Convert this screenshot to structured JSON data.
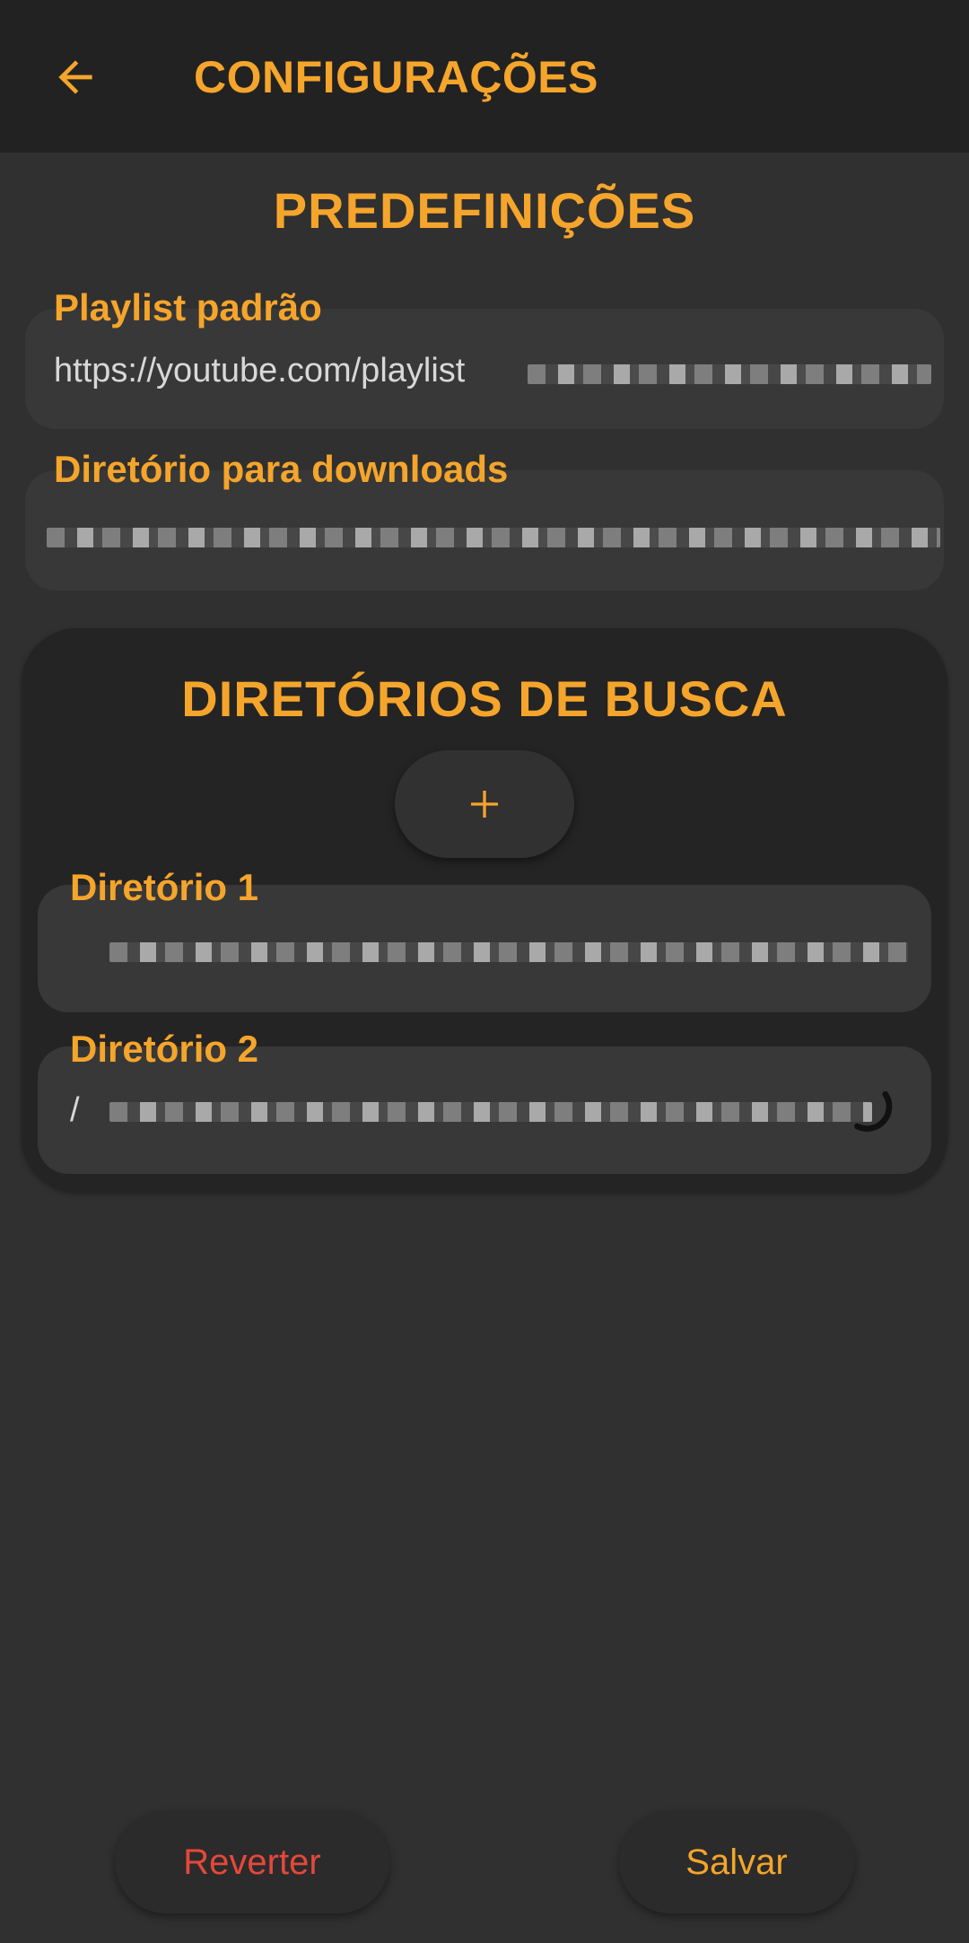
{
  "appbar": {
    "title": "CONFIGURAÇÕES",
    "back_icon": "arrow-left-icon"
  },
  "presets": {
    "title": "PREDEFINIÇÕES",
    "playlist": {
      "label": "Playlist padrão",
      "value": "https://youtube.com/playlist"
    },
    "download_dir": {
      "label": "Diretório para downloads",
      "value": ""
    }
  },
  "search_dirs": {
    "title": "DIRETÓRIOS DE BUSCA",
    "add_icon": "plus-icon",
    "items": [
      {
        "label": "Diretório 1",
        "value": ""
      },
      {
        "label": "Diretório 2",
        "value": "/"
      }
    ]
  },
  "footer": {
    "revert_label": "Reverter",
    "save_label": "Salvar"
  },
  "colors": {
    "accent": "#f5a52b",
    "danger": "#e5483b",
    "background": "#303030",
    "appbar": "#222222",
    "field": "#383838",
    "card": "#242424"
  }
}
